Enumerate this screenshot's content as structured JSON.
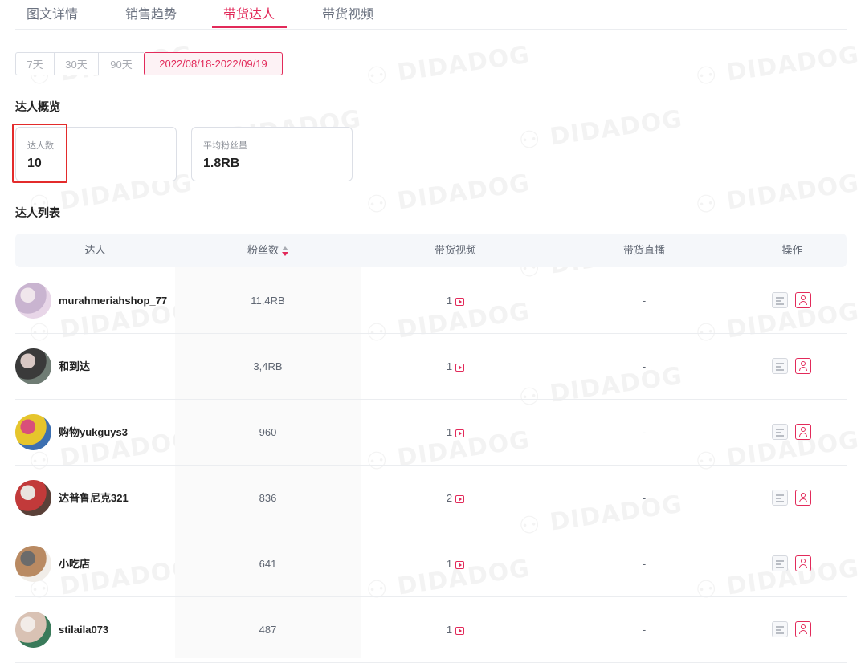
{
  "tabs": [
    {
      "label": "图文详情",
      "active": false
    },
    {
      "label": "销售趋势",
      "active": false
    },
    {
      "label": "带货达人",
      "active": true
    },
    {
      "label": "带货视频",
      "active": false
    }
  ],
  "date_range": {
    "options": [
      "7天",
      "30天",
      "90天"
    ],
    "selected": "2022/08/18-2022/09/19"
  },
  "overview": {
    "title": "达人概览",
    "cards": [
      {
        "label": "达人数",
        "value": "10"
      },
      {
        "label": "平均粉丝量",
        "value": "1.8RB"
      }
    ]
  },
  "list": {
    "title": "达人列表",
    "columns": [
      "达人",
      "粉丝数",
      "带货视频",
      "带货直播",
      "操作"
    ],
    "rows": [
      {
        "name": "murahmeriahshop_77",
        "fans": "11,4RB",
        "videos": "1",
        "live": "-",
        "avatar_colors": [
          "#e8d6e8",
          "#c9b4d0",
          "#f0e6ec"
        ]
      },
      {
        "name": "和到达",
        "fans": "3,4RB",
        "videos": "1",
        "live": "-",
        "avatar_colors": [
          "#6f7c74",
          "#3a3a3a",
          "#d8c8c4"
        ]
      },
      {
        "name": "购物yukguys3",
        "fans": "960",
        "videos": "1",
        "live": "-",
        "avatar_colors": [
          "#3c6fb0",
          "#e6c52c",
          "#d94f7a"
        ]
      },
      {
        "name": "达普鲁尼克321",
        "fans": "836",
        "videos": "2",
        "live": "-",
        "avatar_colors": [
          "#5a4038",
          "#c23a3a",
          "#e9e3de"
        ]
      },
      {
        "name": "小吃店",
        "fans": "641",
        "videos": "1",
        "live": "-",
        "avatar_colors": [
          "#f1ede8",
          "#b98a62",
          "#6b6b6b"
        ]
      },
      {
        "name": "stilaila073",
        "fans": "487",
        "videos": "1",
        "live": "-",
        "avatar_colors": [
          "#3a7a5a",
          "#d9c2b4",
          "#f2ece8"
        ]
      }
    ]
  },
  "watermark": "DIDADOG",
  "colors": {
    "accent": "#e22a5a",
    "highlight": "#e32b2b"
  }
}
